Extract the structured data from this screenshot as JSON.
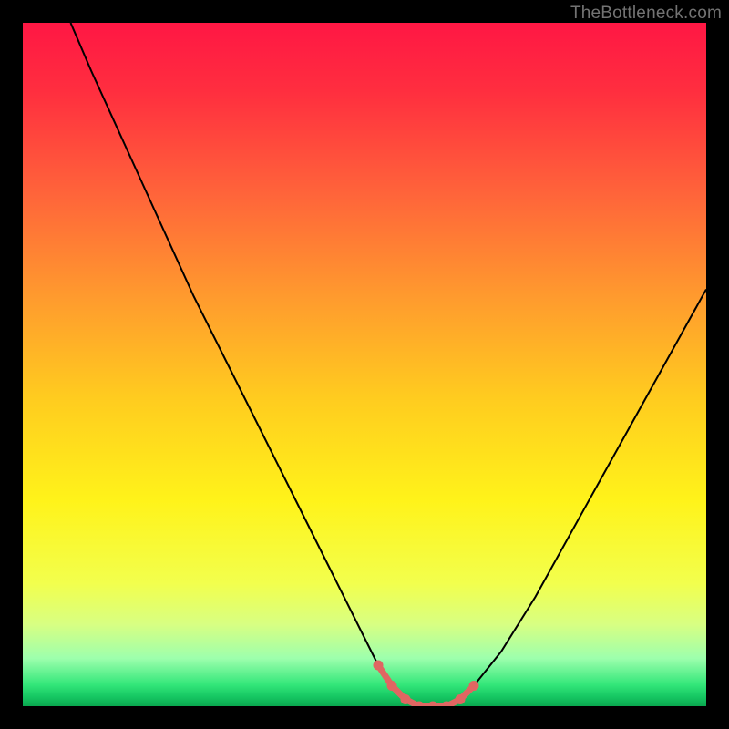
{
  "watermark": "TheBottleneck.com",
  "chart_data": {
    "type": "line",
    "title": "",
    "xlabel": "",
    "ylabel": "",
    "xlim": [
      0,
      100
    ],
    "ylim": [
      0,
      100
    ],
    "series": [
      {
        "name": "curve",
        "x": [
          7,
          10,
          15,
          20,
          25,
          30,
          35,
          40,
          45,
          50,
          52,
          54,
          56,
          58,
          60,
          62,
          64,
          66,
          70,
          75,
          80,
          85,
          90,
          95,
          100
        ],
        "values": [
          100,
          93,
          82,
          71,
          60,
          50,
          40,
          30,
          20,
          10,
          6,
          3,
          1,
          0,
          0,
          0,
          1,
          3,
          8,
          16,
          25,
          34,
          43,
          52,
          61
        ]
      },
      {
        "name": "highlight",
        "x": [
          52,
          54,
          56,
          58,
          60,
          62,
          64,
          66
        ],
        "values": [
          6,
          3,
          1,
          0,
          0,
          0,
          1,
          3
        ]
      }
    ],
    "gradient_stops": [
      {
        "offset": 0.0,
        "color": "#ff1744"
      },
      {
        "offset": 0.1,
        "color": "#ff2e3f"
      },
      {
        "offset": 0.25,
        "color": "#ff643a"
      },
      {
        "offset": 0.4,
        "color": "#ff9a2e"
      },
      {
        "offset": 0.55,
        "color": "#ffcc1f"
      },
      {
        "offset": 0.7,
        "color": "#fff31a"
      },
      {
        "offset": 0.82,
        "color": "#f2ff4d"
      },
      {
        "offset": 0.88,
        "color": "#d8ff82"
      },
      {
        "offset": 0.93,
        "color": "#9dffad"
      },
      {
        "offset": 0.968,
        "color": "#34e77a"
      },
      {
        "offset": 0.985,
        "color": "#17c964"
      },
      {
        "offset": 1.0,
        "color": "#0aa84f"
      }
    ],
    "colors": {
      "curve_stroke": "#000000",
      "highlight_stroke": "#e06662",
      "highlight_fill": "#e06662",
      "background": "#000000"
    }
  }
}
